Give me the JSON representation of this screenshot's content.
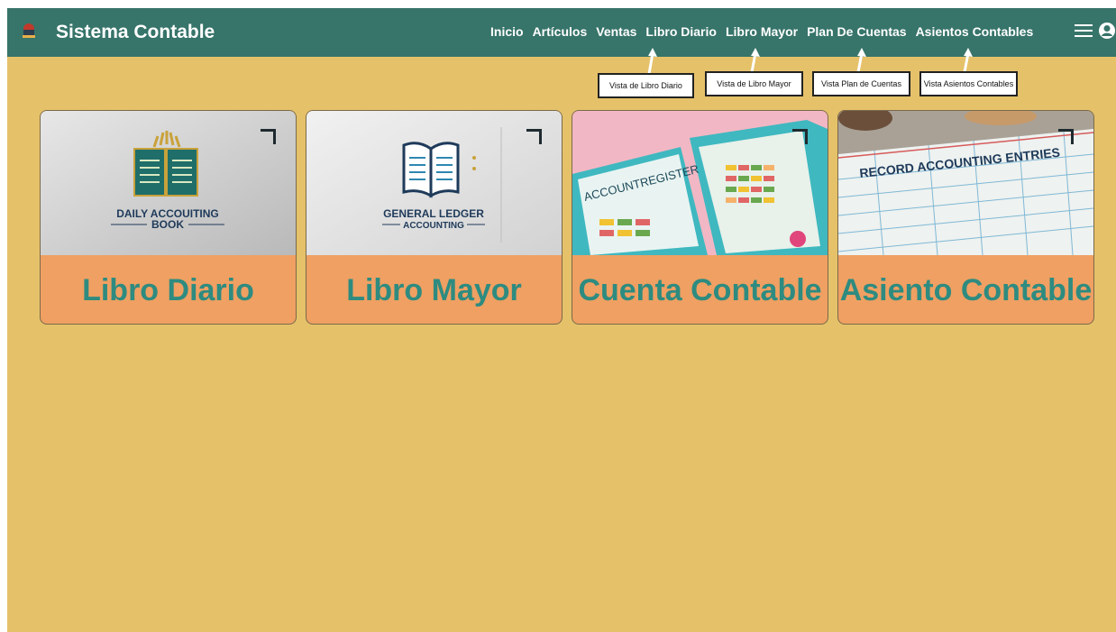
{
  "app": {
    "brand": "Sistema Contable",
    "nav": [
      "Inicio",
      "Artículos",
      "Ventas",
      "Libro Diario",
      "Libro Mayor",
      "Plan De Cuentas",
      "Asientos Contables"
    ]
  },
  "tooltips": [
    "Vista de Libro Diario",
    "Vista de Libro Mayor",
    "Vista Plan de Cuentas",
    "Vista Asientos Contables"
  ],
  "cards": [
    {
      "label": "Libro Diario",
      "image_text": [
        "DAILY ACCOUITING",
        "BOOK"
      ]
    },
    {
      "label": "Libro Mayor",
      "image_text": [
        "GENERAL LEDGER",
        "ACCOUNTING"
      ]
    },
    {
      "label": "Cuenta Contable",
      "image_text": [
        "ACCOUNTREGISTER"
      ]
    },
    {
      "label": "Asiento Contable",
      "image_text": [
        "RECORD ACCOUNTING ENTRIES"
      ]
    }
  ],
  "colors": {
    "navbar": "#37746a",
    "background": "#e5c16a",
    "card_label_bg": "#efa062",
    "card_label_text": "#2e8b80"
  }
}
